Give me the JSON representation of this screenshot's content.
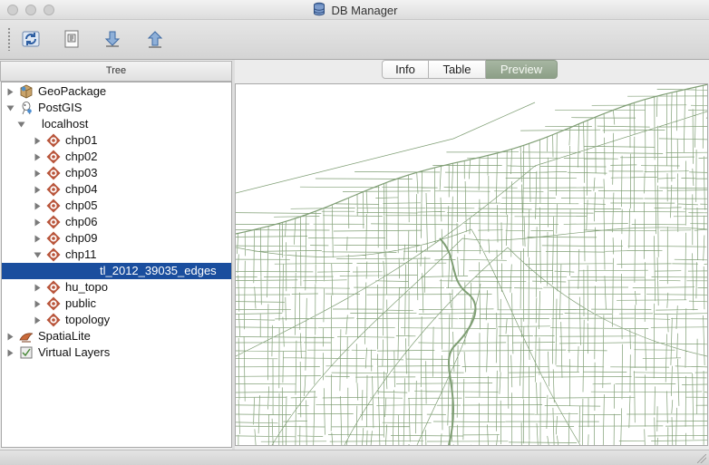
{
  "window": {
    "title": "DB Manager"
  },
  "toolbar": {
    "buttons": [
      {
        "name": "refresh",
        "icon": "refresh-icon"
      },
      {
        "name": "sql-window",
        "icon": "sql-window-icon"
      },
      {
        "name": "import-layer",
        "icon": "import-icon"
      },
      {
        "name": "export-layer",
        "icon": "export-icon"
      }
    ]
  },
  "tree": {
    "header": "Tree",
    "items": [
      {
        "label": "GeoPackage",
        "icon": "geopackage-icon",
        "expanded": false,
        "depth": 0
      },
      {
        "label": "PostGIS",
        "icon": "postgis-icon",
        "expanded": true,
        "depth": 0
      },
      {
        "label": "localhost",
        "icon": "",
        "expanded": true,
        "depth": 1
      },
      {
        "label": "chp01",
        "icon": "schema-icon",
        "expanded": false,
        "depth": 2
      },
      {
        "label": "chp02",
        "icon": "schema-icon",
        "expanded": false,
        "depth": 2
      },
      {
        "label": "chp03",
        "icon": "schema-icon",
        "expanded": false,
        "depth": 2
      },
      {
        "label": "chp04",
        "icon": "schema-icon",
        "expanded": false,
        "depth": 2
      },
      {
        "label": "chp05",
        "icon": "schema-icon",
        "expanded": false,
        "depth": 2
      },
      {
        "label": "chp06",
        "icon": "schema-icon",
        "expanded": false,
        "depth": 2
      },
      {
        "label": "chp09",
        "icon": "schema-icon",
        "expanded": false,
        "depth": 2
      },
      {
        "label": "chp11",
        "icon": "schema-icon",
        "expanded": true,
        "depth": 2
      },
      {
        "label": "tl_2012_39035_edges",
        "icon": "",
        "expanded": null,
        "depth": 3,
        "selected": true
      },
      {
        "label": "hu_topo",
        "icon": "schema-icon",
        "expanded": false,
        "depth": 2
      },
      {
        "label": "public",
        "icon": "schema-icon",
        "expanded": false,
        "depth": 2
      },
      {
        "label": "topology",
        "icon": "schema-icon",
        "expanded": false,
        "depth": 2
      },
      {
        "label": "SpatiaLite",
        "icon": "spatialite-icon",
        "expanded": false,
        "depth": 0
      },
      {
        "label": "Virtual Layers",
        "icon": "virtual-layers-icon",
        "expanded": false,
        "depth": 0
      }
    ]
  },
  "tabs": [
    {
      "label": "Info",
      "active": false
    },
    {
      "label": "Table",
      "active": false
    },
    {
      "label": "Preview",
      "active": true
    }
  ],
  "colors": {
    "selection": "#1a4e9e",
    "map_lines": "#7f9e74",
    "active_tab": "#9aab95",
    "schema_icon": "#b8543a"
  }
}
